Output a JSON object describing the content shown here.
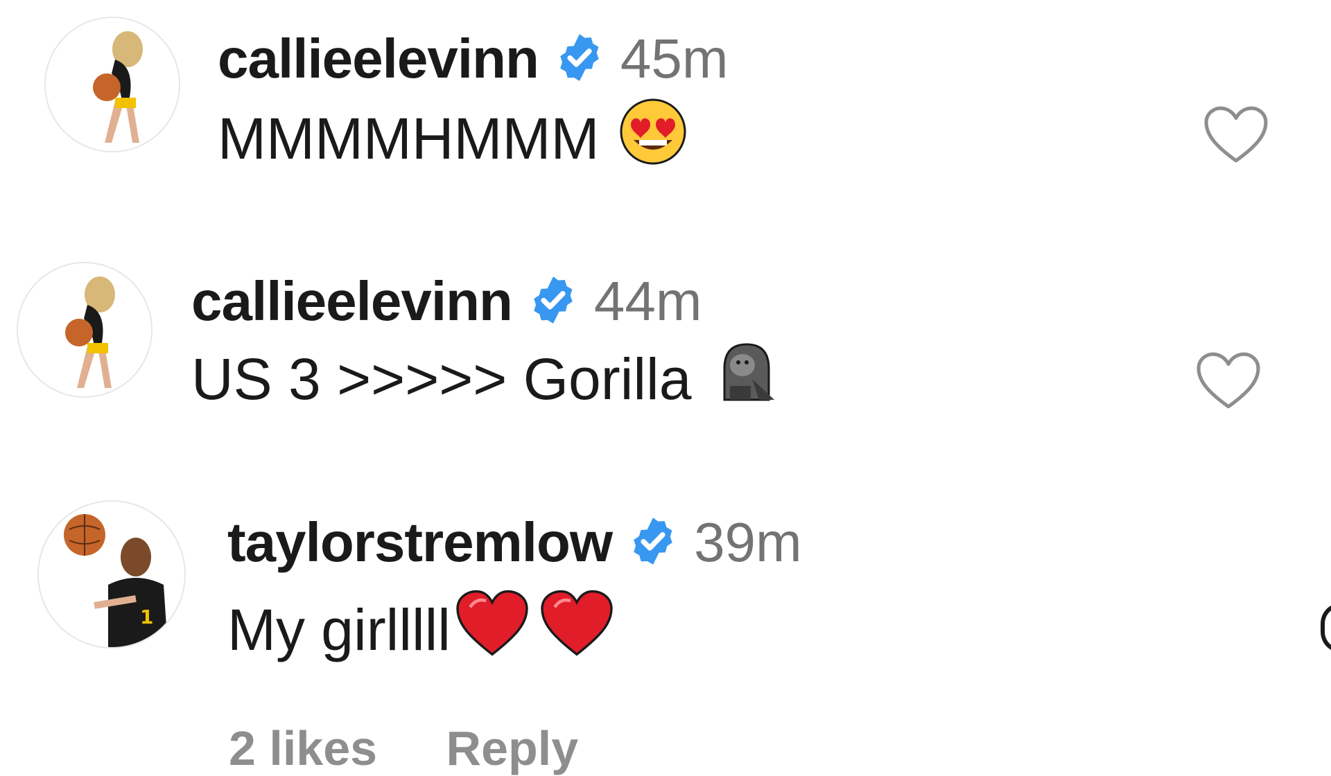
{
  "comments": [
    {
      "username": "callieelevinn",
      "verified": true,
      "time": "45m",
      "text": "MMMMHMMM",
      "emoji": [
        "heart-eyes-emoji"
      ],
      "avatar": "player-holding-basketball"
    },
    {
      "username": "callieelevinn",
      "verified": true,
      "time": "44m",
      "text": "US 3 >>>>> Gorilla",
      "emoji": [
        "gorilla-emoji"
      ],
      "avatar": "player-holding-basketball"
    },
    {
      "username": "taylorstremlow",
      "verified": true,
      "time": "39m",
      "text": "My girlllll",
      "emoji": [
        "red-heart-emoji",
        "red-heart-emoji"
      ],
      "avatar": "player-spinning-basketball"
    }
  ],
  "footer": {
    "likes": "2 likes",
    "reply": "Reply"
  },
  "colors": {
    "verified": "#3897f0",
    "time": "#737373",
    "heart": "#e11d2a"
  }
}
